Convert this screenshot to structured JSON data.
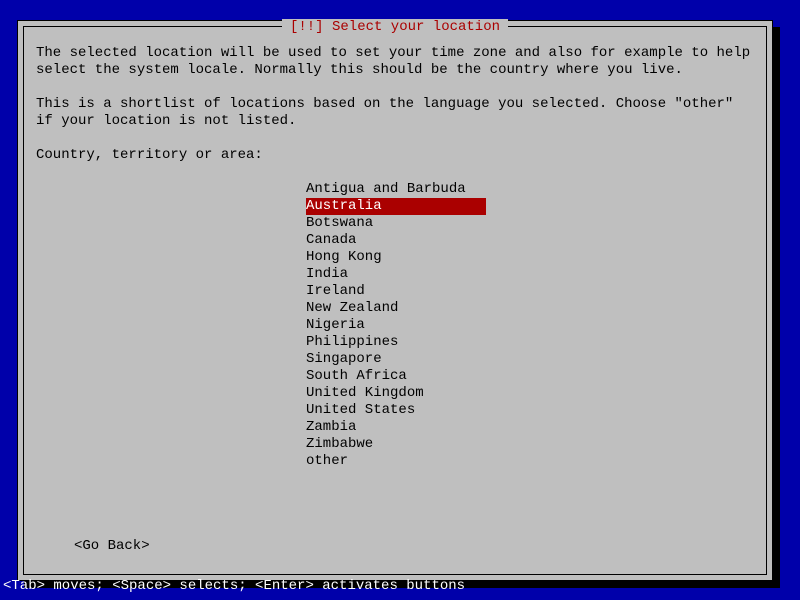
{
  "title": {
    "marker": "[!!]",
    "text": "Select your location"
  },
  "paragraphs": {
    "p1": "The selected location will be used to set your time zone and also for example to help select the system locale. Normally this should be the country where you live.",
    "p2": "This is a shortlist of locations based on the language you selected. Choose \"other\" if your location is not listed."
  },
  "prompt": "Country, territory or area:",
  "locations": [
    "Antigua and Barbuda",
    "Australia",
    "Botswana",
    "Canada",
    "Hong Kong",
    "India",
    "Ireland",
    "New Zealand",
    "Nigeria",
    "Philippines",
    "Singapore",
    "South Africa",
    "United Kingdom",
    "United States",
    "Zambia",
    "Zimbabwe",
    "other"
  ],
  "selected_index": 1,
  "buttons": {
    "go_back": "<Go Back>"
  },
  "hint": "<Tab> moves; <Space> selects; <Enter> activates buttons",
  "list_pad_width": 20
}
